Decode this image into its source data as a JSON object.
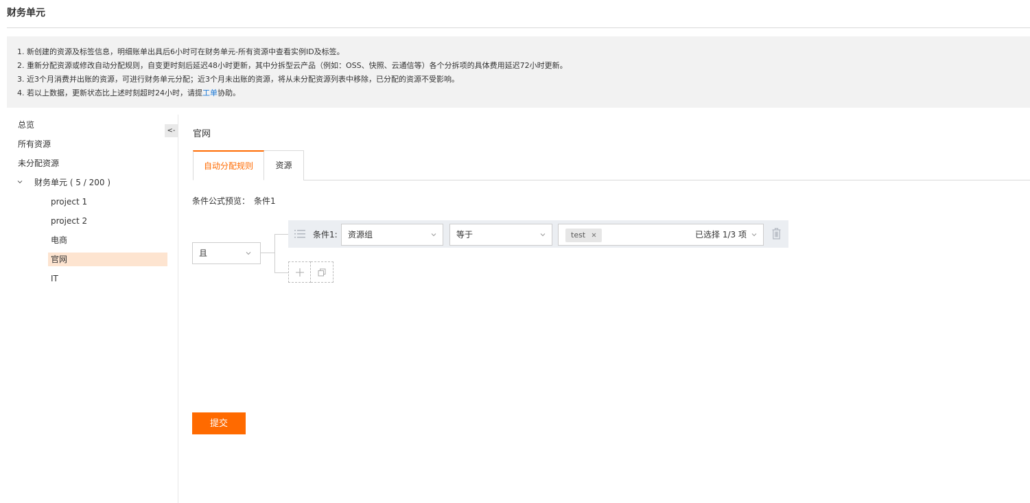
{
  "page": {
    "title": "财务单元"
  },
  "notice": {
    "line1": "1. 新创建的资源及标签信息，明细账单出具后6小时可在财务单元-所有资源中查看实例ID及标签。",
    "line2": "2. 重新分配资源或修改自动分配规则，自变更时刻后延迟48小时更新，其中分拆型云产品（例如：OSS、快照、云通信等）各个分拆项的具体费用延迟72小时更新。",
    "line3": "3. 近3个月消费并出账的资源，可进行财务单元分配；近3个月未出账的资源，将从未分配资源列表中移除，已分配的资源不受影响。",
    "line4_prefix": "4. 若以上数据，更新状态比上述时刻超时24小时，请提",
    "line4_link": "工单",
    "line4_suffix": "协助。"
  },
  "sidebar": {
    "collapse_label": "<-",
    "overview": "总览",
    "all_resources": "所有资源",
    "unassigned": "未分配资源",
    "group_label": "财务单元 ( 5 / 200 )",
    "children": [
      "project 1",
      "project 2",
      "电商",
      "官网",
      "IT"
    ],
    "active_child": "官网"
  },
  "main": {
    "title": "官网",
    "tabs": [
      {
        "label": "自动分配规则",
        "active": true
      },
      {
        "label": "资源",
        "active": false
      }
    ],
    "formula_label": "条件公式预览：",
    "formula_value": "条件1",
    "logic_operator": "且",
    "condition": {
      "label": "条件1:",
      "field": "资源组",
      "operator": "等于",
      "tag": "test",
      "selected_count": "已选择 1/3 项"
    },
    "submit_label": "提交"
  },
  "colors": {
    "accent": "#ff6a00",
    "link": "#1e7ad6",
    "active_bg": "#fde4d0",
    "notice_bg": "#f2f2f2",
    "condition_bg": "#ebeef2"
  },
  "icons": [
    "chevron-down-icon",
    "drag-handle-icon",
    "close-icon",
    "trash-icon",
    "plus-icon",
    "copy-icon"
  ]
}
